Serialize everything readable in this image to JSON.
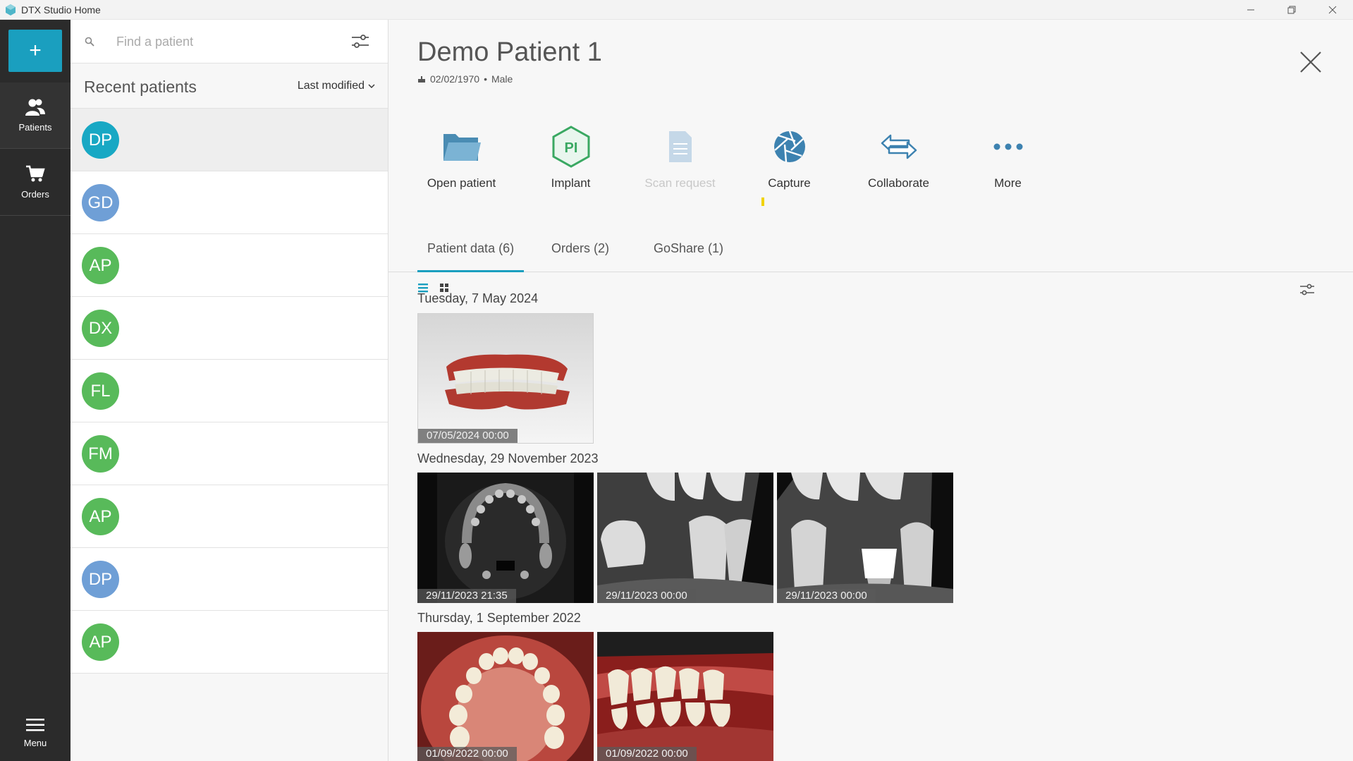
{
  "window": {
    "title": "DTX Studio Home"
  },
  "rail": {
    "add_label": "+",
    "items": [
      {
        "label": "Patients"
      },
      {
        "label": "Orders"
      }
    ],
    "menu_label": "Menu"
  },
  "search": {
    "placeholder": "Find a patient"
  },
  "recent": {
    "title": "Recent patients",
    "sort_label": "Last modified"
  },
  "patients": [
    {
      "initials": "DP",
      "color": "#18a8c4"
    },
    {
      "initials": "GD",
      "color": "#6f9fd6"
    },
    {
      "initials": "AP",
      "color": "#58ba5a"
    },
    {
      "initials": "DX",
      "color": "#58ba5a"
    },
    {
      "initials": "FL",
      "color": "#58ba5a"
    },
    {
      "initials": "FM",
      "color": "#58ba5a"
    },
    {
      "initials": "AP",
      "color": "#58ba5a"
    },
    {
      "initials": "DP",
      "color": "#6f9fd6"
    },
    {
      "initials": "AP",
      "color": "#58ba5a"
    }
  ],
  "patient": {
    "name": "Demo Patient 1",
    "dob": "02/02/1970",
    "separator": "•",
    "sex": "Male"
  },
  "actions": [
    {
      "label": "Open patient",
      "icon": "folder-icon"
    },
    {
      "label": "Implant",
      "icon": "implant-pi-icon"
    },
    {
      "label": "Scan request",
      "icon": "document-icon",
      "disabled": true
    },
    {
      "label": "Capture",
      "icon": "aperture-icon"
    },
    {
      "label": "Collaborate",
      "icon": "exchange-arrows-icon"
    },
    {
      "label": "More",
      "icon": "more-dots-icon"
    }
  ],
  "implant_icon_text": "PI",
  "tabs": [
    {
      "label": "Patient data (6)",
      "active": true
    },
    {
      "label": "Orders (2)"
    },
    {
      "label": "GoShare (1)"
    }
  ],
  "groups": [
    {
      "date": "Tuesday, 7 May 2024",
      "items": [
        {
          "stamp": "07/05/2024 00:00",
          "kind": "3d-scan"
        }
      ]
    },
    {
      "date": "Wednesday, 29 November 2023",
      "items": [
        {
          "stamp": "29/11/2023 21:35",
          "kind": "ct-slice"
        },
        {
          "stamp": "29/11/2023 00:00",
          "kind": "xray-1"
        },
        {
          "stamp": "29/11/2023 00:00",
          "kind": "xray-2"
        }
      ]
    },
    {
      "date": "Thursday, 1 September 2022",
      "items": [
        {
          "stamp": "01/09/2022 00:00",
          "kind": "photo-occlusal"
        },
        {
          "stamp": "01/09/2022 00:00",
          "kind": "photo-lateral"
        }
      ]
    }
  ],
  "colors": {
    "accent": "#1a9fbf",
    "rail": "#2b2b2b"
  }
}
